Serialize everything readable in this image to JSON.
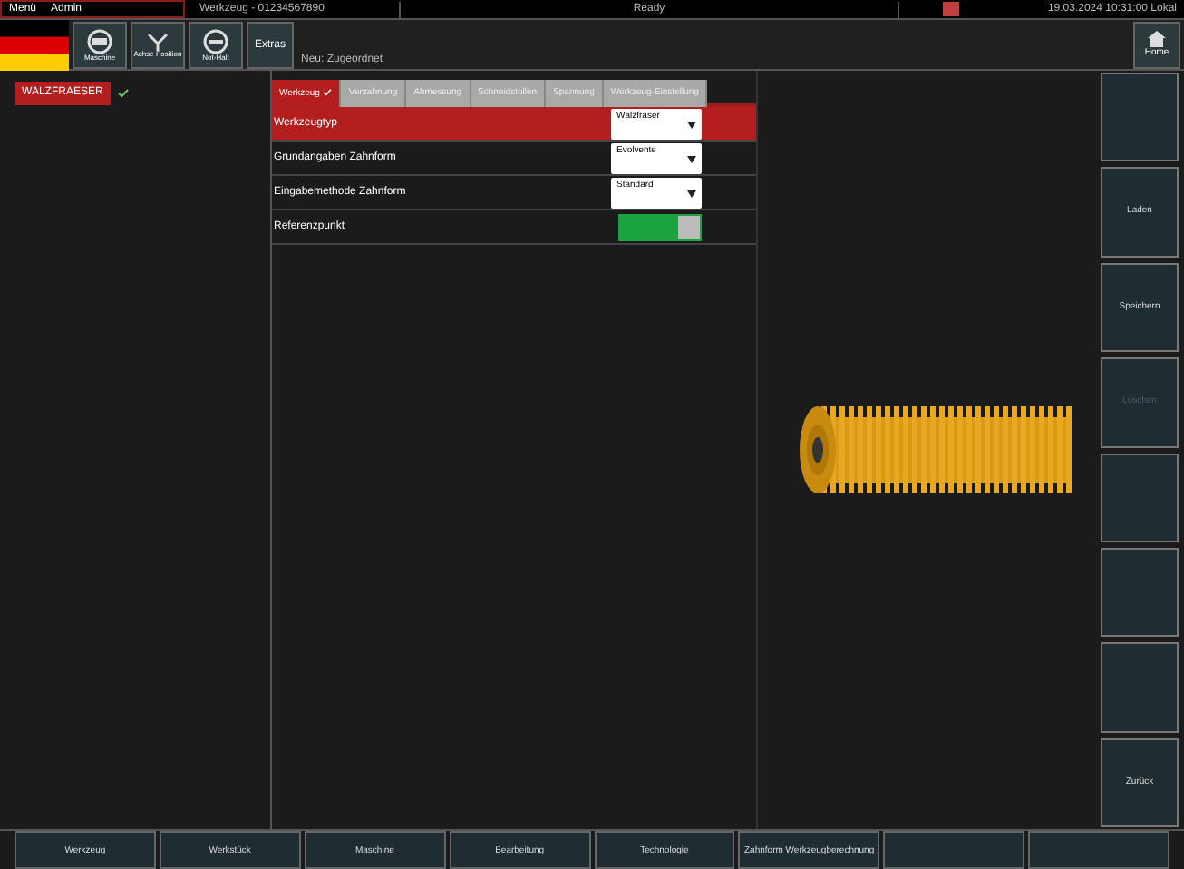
{
  "top_bar": {
    "menu": "Menü",
    "user": "Admin",
    "job": "Werkzeug - 01234567890",
    "status": "Ready",
    "datetime": "19.03.2024 10:31:00 Lokal"
  },
  "toolbar": {
    "buttons": [
      {
        "kind": "drum",
        "label": "Maschine"
      },
      {
        "kind": "axis",
        "label": "Achse Position"
      },
      {
        "kind": "stop",
        "label": "Not-Halt"
      }
    ],
    "mode": "Extras",
    "breadcrumb": "Neu: Zugeordnet",
    "home": "Home"
  },
  "tree": [
    {
      "label": "WALZFRAESER",
      "selected": true,
      "done": true
    }
  ],
  "tabs": [
    {
      "label": "Werkzeug",
      "selected": true,
      "done": true
    },
    {
      "label": "Verzahnung",
      "selected": false,
      "done": false
    },
    {
      "label": "Abmessung",
      "selected": false,
      "done": false
    },
    {
      "label": "Schneidstollen",
      "selected": false,
      "done": false
    },
    {
      "label": "Spannung",
      "selected": false,
      "done": false
    },
    {
      "label": "Werkzeug-Einstellung",
      "selected": false,
      "done": false
    }
  ],
  "rows": [
    {
      "kind": "dropdown",
      "label": "Werkzeugtyp",
      "value": "Wälzfräser",
      "selected": true
    },
    {
      "kind": "dropdown",
      "label": "Grundangaben Zahnform",
      "value": "Evolvente",
      "selected": false
    },
    {
      "kind": "dropdown",
      "label": "Eingabemethode Zahnform",
      "value": "Standard",
      "selected": false
    },
    {
      "kind": "toggle",
      "label": "Referenzpunkt",
      "on": true,
      "selected": false
    }
  ],
  "side_buttons": [
    {
      "kind": "blank"
    },
    {
      "kind": "labeled",
      "label": "Laden",
      "disabled": false
    },
    {
      "kind": "labeled",
      "label": "Speichern",
      "disabled": false
    },
    {
      "kind": "labeled",
      "label": "Löschen",
      "disabled": true
    },
    {
      "kind": "blank"
    },
    {
      "kind": "blank"
    },
    {
      "kind": "blank"
    },
    {
      "kind": "labeled",
      "label": "Zurück",
      "disabled": false
    }
  ],
  "bottom_buttons": [
    {
      "kind": "labeled",
      "label": "Werkzeug"
    },
    {
      "kind": "labeled",
      "label": "Werkstück"
    },
    {
      "kind": "labeled",
      "label": "Maschine"
    },
    {
      "kind": "labeled",
      "label": "Bearbeitung"
    },
    {
      "kind": "labeled",
      "label": "Technologie"
    },
    {
      "kind": "labeled",
      "label": "Zahnform Werkzeugberechnung"
    },
    {
      "kind": "blank"
    },
    {
      "kind": "blank"
    }
  ]
}
